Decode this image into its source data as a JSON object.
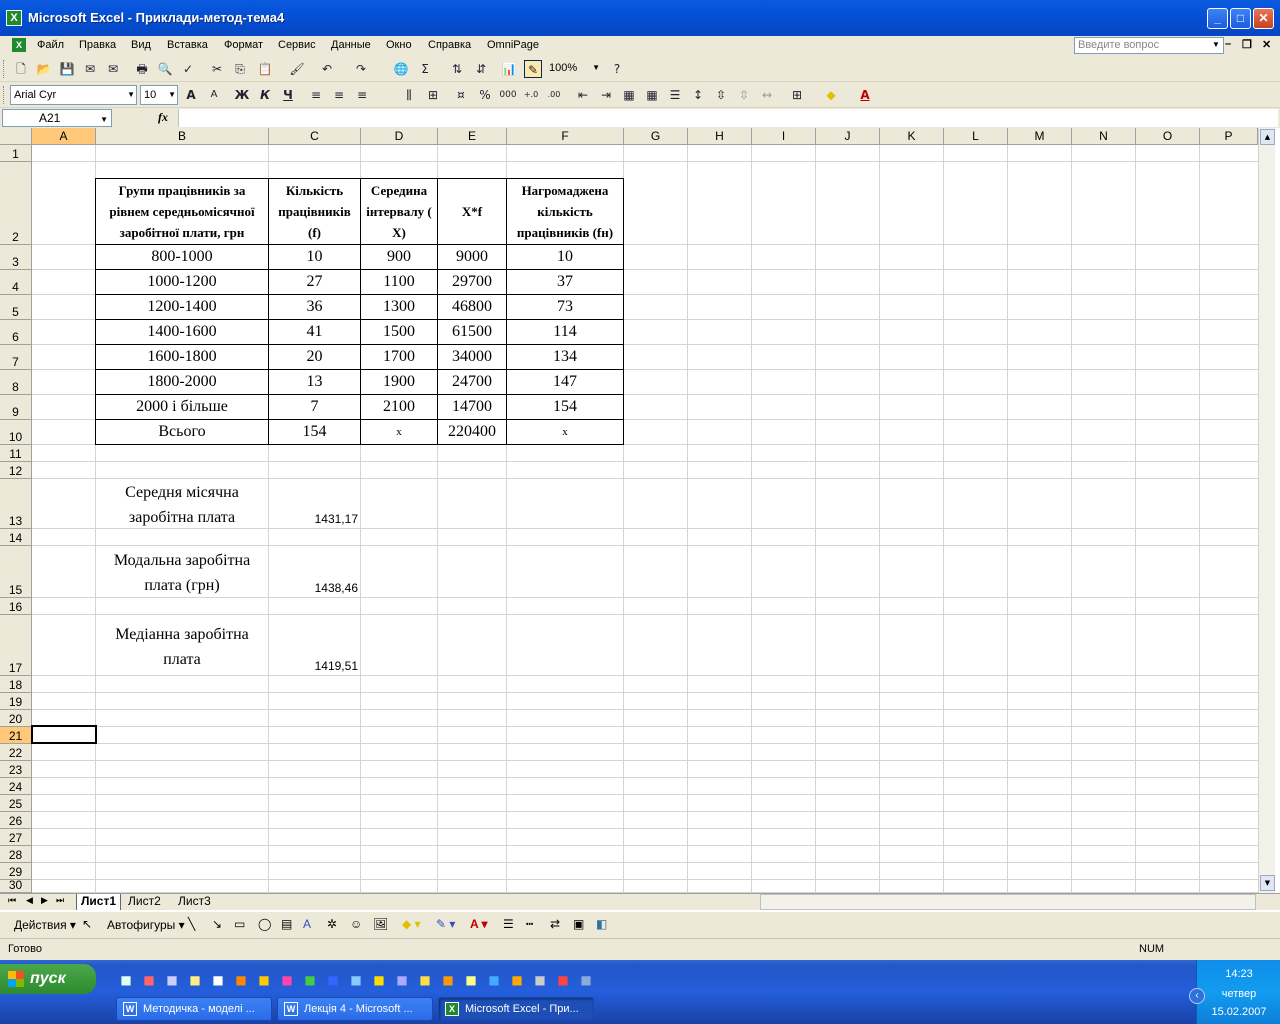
{
  "window": {
    "title": "Microsoft Excel - Приклади-метод-тема4"
  },
  "menu": {
    "items": [
      "Файл",
      "Правка",
      "Вид",
      "Вставка",
      "Формат",
      "Сервис",
      "Данные",
      "Окно",
      "Справка",
      "OmniPage"
    ],
    "question_placeholder": "Введите вопрос"
  },
  "toolbar": {
    "zoom": "100%",
    "font_name": "Arial Cyr",
    "font_size": "10"
  },
  "formula_bar": {
    "name_box": "A21",
    "fx": "fx",
    "formula": ""
  },
  "columns": [
    "A",
    "B",
    "C",
    "D",
    "E",
    "F",
    "G",
    "H",
    "I",
    "J",
    "K",
    "L",
    "M",
    "N",
    "O",
    "P"
  ],
  "rows": [
    "1",
    "2",
    "3",
    "4",
    "5",
    "6",
    "7",
    "8",
    "9",
    "10",
    "11",
    "12",
    "13",
    "14",
    "15",
    "16",
    "17",
    "18",
    "19",
    "20",
    "21",
    "22",
    "23",
    "24",
    "25",
    "26",
    "27",
    "28",
    "29",
    "30"
  ],
  "table": {
    "headers": [
      "Групи працівників за рівнем середньомісячної заробітної плати, грн",
      "Кількість працівників (f)",
      "Середина інтервалу ( X)",
      "X*f",
      "Нагромаджена кількість працівників (fн)"
    ],
    "rows": [
      [
        "800-1000",
        "10",
        "900",
        "9000",
        "10"
      ],
      [
        "1000-1200",
        "27",
        "1100",
        "29700",
        "37"
      ],
      [
        "1200-1400",
        "36",
        "1300",
        "46800",
        "73"
      ],
      [
        "1400-1600",
        "41",
        "1500",
        "61500",
        "114"
      ],
      [
        "1600-1800",
        "20",
        "1700",
        "34000",
        "134"
      ],
      [
        "1800-2000",
        "13",
        "1900",
        "24700",
        "147"
      ],
      [
        "2000 і більше",
        "7",
        "2100",
        "14700",
        "154"
      ],
      [
        "Всього",
        "154",
        "х",
        "220400",
        "х"
      ]
    ]
  },
  "results": [
    {
      "label": "Середня місячна заробітна плата",
      "value": "1431,17"
    },
    {
      "label": "Модальна заробітна плата (грн)",
      "value": "1438,46"
    },
    {
      "label": "Медіанна заробітна плата",
      "value": "1419,51"
    }
  ],
  "sheets": [
    "Лист1",
    "Лист2",
    "Лист3"
  ],
  "draw_toolbar": {
    "actions": "Действия",
    "autoshapes": "Автофигуры"
  },
  "status": {
    "left": "Готово",
    "num": "NUM"
  },
  "taskbar": {
    "start": "пуск",
    "buttons": [
      "Методичка - моделі ...",
      "Лекція 4 - Microsoft ...",
      "Microsoft Excel - При..."
    ],
    "time": "14:23",
    "day": "четвер",
    "date": "15.02.2007"
  }
}
